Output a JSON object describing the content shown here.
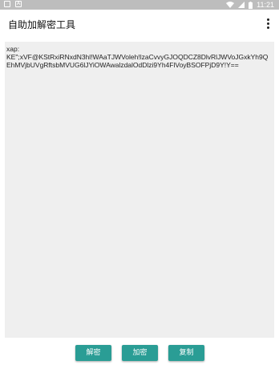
{
  "status_bar": {
    "time": "11:21",
    "icons": [
      "notification-icon",
      "sim-icon",
      "wifi-icon",
      "signal-icon",
      "battery-icon"
    ],
    "background_color": "#bdbdbd"
  },
  "app_bar": {
    "title": "自助加解密工具",
    "menu_icon": "more-vert-icon"
  },
  "editor": {
    "content": "xap:\nKE\";xVF@KStRxiRNxdN3hl!WAaTJWVoleh!lzaCvvyGJOQDCZ8DlvRlJWVoJGxkYh9QEhMVjbUVgRftsbMVUG6lJYiOWAwalzdalOdDlzi9Yh4FlVoyBSOFPjD9Y!Y=="
  },
  "buttons": {
    "decrypt_label": "解密",
    "encrypt_label": "加密",
    "copy_label": "复制"
  },
  "colors": {
    "accent": "#2a9d95",
    "editor_background": "#efefef"
  }
}
